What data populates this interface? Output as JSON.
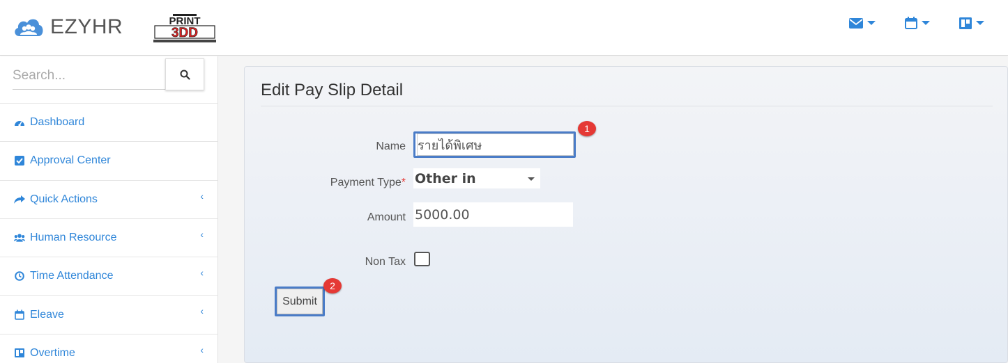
{
  "app": {
    "name": "EZYHR",
    "company_logo_text_top": "PRINT",
    "company_logo_text_bottom": "3DD"
  },
  "header": {
    "icons": [
      "envelope-icon",
      "calendar-icon",
      "board-icon"
    ]
  },
  "sidebar": {
    "search_placeholder": "Search...",
    "items": [
      {
        "label": "Dashboard",
        "icon": "dashboard-icon",
        "expandable": false
      },
      {
        "label": "Approval Center",
        "icon": "check-square-icon",
        "expandable": false
      },
      {
        "label": "Quick Actions",
        "icon": "share-icon",
        "expandable": true
      },
      {
        "label": "Human Resource",
        "icon": "users-icon",
        "expandable": true
      },
      {
        "label": "Time Attendance",
        "icon": "clock-icon",
        "expandable": true
      },
      {
        "label": "Eleave",
        "icon": "calendar-icon",
        "expandable": true
      },
      {
        "label": "Overtime",
        "icon": "board-icon",
        "expandable": true
      }
    ]
  },
  "form": {
    "title": "Edit Pay Slip Detail",
    "name_label": "Name",
    "name_value": "รายได้พิเศษ",
    "payment_type_label": "Payment Type",
    "payment_type_required": "*",
    "payment_type_value": "Other in",
    "amount_label": "Amount",
    "amount_value": "5000.00",
    "non_tax_label": "Non Tax",
    "non_tax_checked": false,
    "submit_label": "Submit"
  },
  "annotations": {
    "badge_1": "1",
    "badge_2": "2"
  },
  "colors": {
    "accent": "#2f86d9",
    "highlight_border": "#4a7cc7",
    "badge": "#e53935"
  }
}
